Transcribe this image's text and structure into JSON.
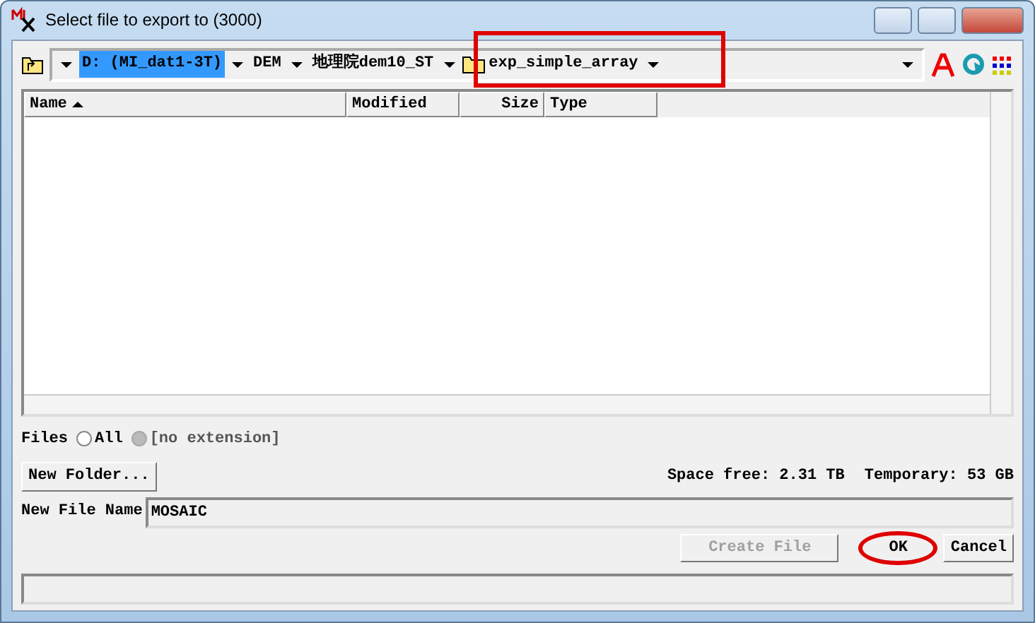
{
  "window": {
    "title": "Select file to export to (3000)"
  },
  "path": [
    {
      "label": "D: (MI_dat1-3T)",
      "selected": true,
      "kind": "drive"
    },
    {
      "label": "DEM",
      "selected": false,
      "kind": "folder"
    },
    {
      "label": "地理院dem10_ST",
      "selected": false,
      "kind": "folder"
    },
    {
      "label": "exp_simple_array",
      "selected": false,
      "kind": "current"
    }
  ],
  "table": {
    "columns": [
      {
        "label": "Name",
        "sorted": true
      },
      {
        "label": "Modified",
        "sorted": false
      },
      {
        "label": "Size",
        "sorted": false
      },
      {
        "label": "Type",
        "sorted": false
      }
    ]
  },
  "files_filter": {
    "label": "Files",
    "options": [
      {
        "label": "All",
        "selected": false,
        "disabled": false
      },
      {
        "label": "[no extension]",
        "selected": true,
        "disabled": true
      }
    ]
  },
  "new_folder_button": "New Folder...",
  "space_free": "Space free: 2.31 TB",
  "temporary": "Temporary: 53 GB",
  "new_file_name": {
    "label": "New File Name",
    "value": "MOSAIC"
  },
  "buttons": [
    {
      "label": "Create File",
      "disabled": true,
      "highlighted": false
    },
    {
      "label": "OK",
      "disabled": false,
      "highlighted": true
    },
    {
      "label": "Cancel",
      "disabled": false,
      "highlighted": false
    }
  ]
}
